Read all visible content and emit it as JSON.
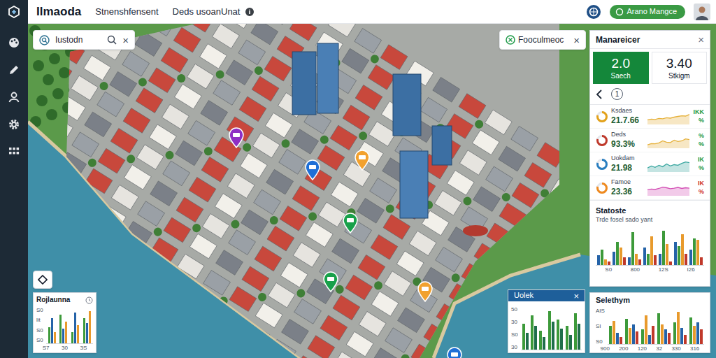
{
  "app": {
    "title": "Ilmaoda",
    "nav": [
      "Stnenshfensent",
      "Deds usoanUnat"
    ]
  },
  "user": {
    "name": "Arano Mangce"
  },
  "search": {
    "value": "Iustodn",
    "clear": "×"
  },
  "filter": {
    "label": "Fooculmeoc",
    "clear": "×"
  },
  "map": {
    "pins": [
      {
        "color": "#8e2fc4"
      },
      {
        "color": "#1f6fd6"
      },
      {
        "color": "#f2a12e"
      },
      {
        "color": "#18a04a"
      },
      {
        "color": "#18a04a"
      },
      {
        "color": "#f2a12e"
      },
      {
        "color": "#1f6fd6"
      }
    ]
  },
  "manager": {
    "title": "Manareicer",
    "close": "×",
    "stats": [
      {
        "value": "2.0",
        "label": "Saech",
        "selected": true
      },
      {
        "value": "3.40",
        "label": "Stkigm",
        "selected": false
      }
    ],
    "page": "1",
    "metrics": [
      {
        "label": "Ksdaes",
        "value": "21.7.66",
        "delta": "IKK",
        "unit": "%",
        "color": "#e3a21a",
        "delta_color": "#1e9a48",
        "spark_color": "#e6b13a",
        "spark": [
          30,
          35,
          32,
          40,
          38,
          45,
          42,
          50,
          55,
          60,
          58,
          70
        ]
      },
      {
        "label": "Deds",
        "value": "93.3%",
        "delta": "%",
        "unit": "%",
        "color": "#c0392b",
        "delta_color": "#1e9a48",
        "spark_color": "#e6b13a",
        "spark": [
          20,
          30,
          28,
          35,
          50,
          40,
          38,
          55,
          45,
          50,
          65,
          60
        ]
      },
      {
        "label": "Uokdam",
        "value": "21.98",
        "delta": "IK",
        "unit": "%",
        "color": "#2a7fc0",
        "delta_color": "#1e9a48",
        "spark_color": "#3aa7a0",
        "spark": [
          25,
          40,
          30,
          45,
          35,
          55,
          40,
          50,
          45,
          60,
          70,
          65
        ]
      },
      {
        "label": "Famoe",
        "value": "23.36",
        "delta": "IK",
        "unit": "%",
        "color": "#ef8a1f",
        "delta_color": "#d0342c",
        "spark_color": "#d34fb5",
        "spark": [
          40,
          45,
          42,
          50,
          60,
          55,
          48,
          52,
          58,
          50,
          55,
          52
        ]
      }
    ]
  },
  "statistics": {
    "title": "Statoste",
    "subtitle": "Trde fosel sado yant",
    "chart": {
      "y_ticks": [],
      "x_labels": [
        "S0",
        "800",
        "12S",
        "I26"
      ],
      "series": [
        {
          "color": "#2563a8",
          "values": [
            25,
            35,
            20,
            45,
            30,
            60,
            40
          ]
        },
        {
          "color": "#3d9a3a",
          "values": [
            40,
            60,
            85,
            30,
            90,
            50,
            70
          ]
        },
        {
          "color": "#e89a2c",
          "values": [
            15,
            45,
            30,
            75,
            55,
            80,
            65
          ]
        },
        {
          "color": "#c0392b",
          "values": [
            10,
            20,
            15,
            25,
            10,
            30,
            20
          ]
        }
      ]
    }
  },
  "panels": {
    "uolek": {
      "title": "Uolek",
      "close": "×",
      "chart": {
        "y_ticks": [
          "50",
          "30",
          "S0",
          "30"
        ],
        "x_labels": [],
        "series": [
          {
            "color": "#3d9a3a",
            "values": [
              60,
              80,
              45,
              90,
              70,
              55,
              85
            ]
          },
          {
            "color": "#1f6e4a",
            "values": [
              40,
              55,
              30,
              65,
              50,
              35,
              60
            ]
          }
        ]
      }
    },
    "selethym": {
      "title": "Selethym",
      "chart": {
        "y_ticks": [
          "AIS",
          "SI",
          "S0"
        ],
        "x_labels": [
          "900",
          "200",
          "120",
          "32",
          "330",
          "316"
        ],
        "series": [
          {
            "color": "#3d9a3a",
            "values": [
              50,
              70,
              40,
              85,
              60,
              75
            ]
          },
          {
            "color": "#e89a2c",
            "values": [
              65,
              45,
              80,
              55,
              90,
              50
            ]
          },
          {
            "color": "#2563a8",
            "values": [
              30,
              55,
              25,
              40,
              45,
              60
            ]
          },
          {
            "color": "#c0392b",
            "values": [
              20,
              35,
              50,
              30,
              25,
              40
            ]
          }
        ]
      }
    },
    "rojlaunna": {
      "title": "Rojlaunna",
      "chart": {
        "y_ticks": [
          "S0",
          "lit",
          "S0",
          "S0"
        ],
        "x_labels": [
          "S7",
          "30",
          "3S"
        ],
        "series": [
          {
            "color": "#3d9a3a",
            "values": [
              45,
              80,
              30,
              70
            ]
          },
          {
            "color": "#2563a8",
            "values": [
              70,
              40,
              85,
              55
            ]
          },
          {
            "color": "#e89a2c",
            "values": [
              30,
              60,
              50,
              90
            ]
          }
        ]
      }
    }
  }
}
